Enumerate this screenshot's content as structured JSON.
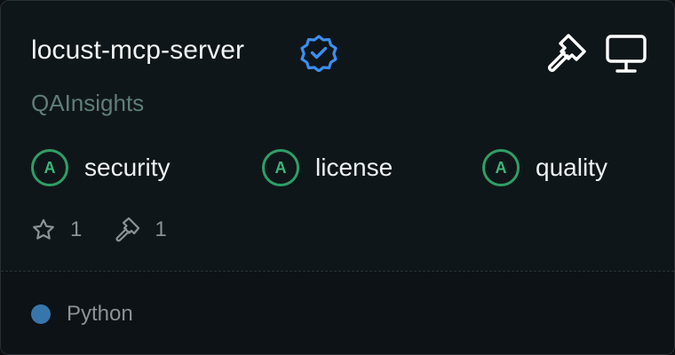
{
  "server": {
    "name": "locust-mcp-server",
    "owner": "QAInsights",
    "verified_icon": "verified-badge-icon",
    "capability_icons": [
      "tools-icon",
      "desktop-icon"
    ]
  },
  "scores": [
    {
      "grade": "A",
      "label": "security"
    },
    {
      "grade": "A",
      "label": "license"
    },
    {
      "grade": "A",
      "label": "quality"
    }
  ],
  "stats": {
    "stars": "1",
    "tools": "1"
  },
  "language": {
    "name": "Python",
    "color": "#3776ab"
  },
  "colors": {
    "grade_accent": "#2f9e67",
    "verified_accent": "#3b8ff3"
  }
}
